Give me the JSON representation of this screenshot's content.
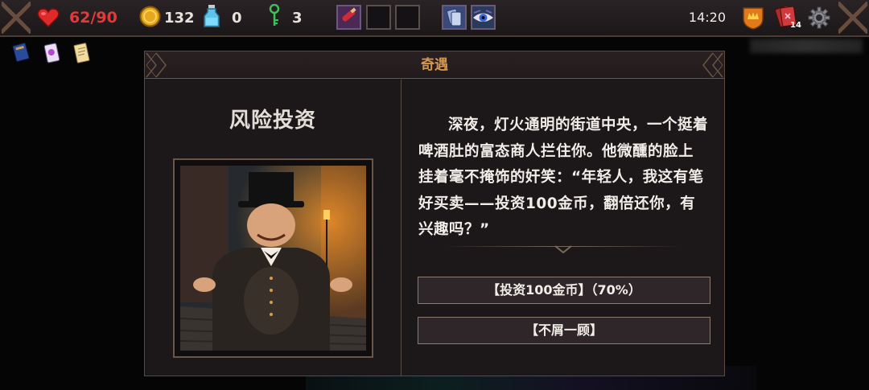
{
  "status": {
    "hp": "62/90",
    "gold": "132",
    "potions": "0",
    "keys": "3",
    "time": "14:20",
    "deck_count": "14"
  },
  "event": {
    "header": "奇遇",
    "name": "风险投资",
    "description": "深夜，灯火通明的街道中央，一个挺着啤酒肚的富态商人拦住你。他微醺的脸上挂着毫不掩饰的奸笑：“年轻人，我这有笔好买卖——投资100金币，翻倍还你，有兴趣吗？”",
    "choices": [
      {
        "label": "【投资100金币】（70%）"
      },
      {
        "label": "【不屑一顾】"
      }
    ]
  },
  "icons": {
    "hp": "heart-icon",
    "gold": "coin-icon",
    "potion": "potion-bottle-icon",
    "key": "key-icon",
    "rank": "crown-badge-icon",
    "deck": "card-deck-icon",
    "settings": "gear-icon"
  },
  "colors": {
    "hp_text": "#e03a3a",
    "header_title": "#d29752",
    "panel_bg": "#1c1718",
    "border": "#5a4a40"
  }
}
